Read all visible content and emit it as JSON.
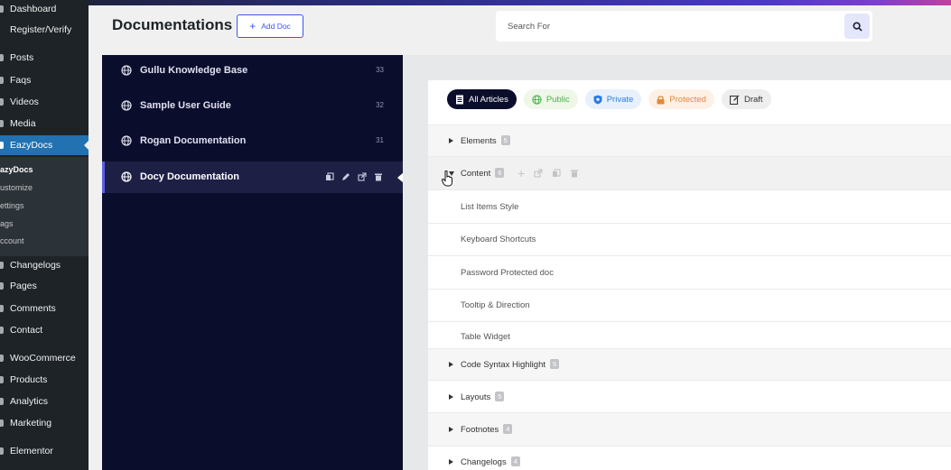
{
  "wp_menu": {
    "items": [
      {
        "label": "Dashboard"
      },
      {
        "label": "Register/Verify"
      },
      {
        "label": "Posts"
      },
      {
        "label": "Faqs"
      },
      {
        "label": "Videos"
      },
      {
        "label": "Media"
      },
      {
        "label": "EazyDocs"
      },
      {
        "label": "Changelogs"
      },
      {
        "label": "Pages"
      },
      {
        "label": "Comments"
      },
      {
        "label": "Contact"
      },
      {
        "label": "WooCommerce"
      },
      {
        "label": "Products"
      },
      {
        "label": "Analytics"
      },
      {
        "label": "Marketing"
      },
      {
        "label": "Elementor"
      }
    ],
    "submenu": [
      {
        "label": "azyDocs"
      },
      {
        "label": "ustomize"
      },
      {
        "label": "ettings"
      },
      {
        "label": "ags"
      },
      {
        "label": "ccount"
      }
    ]
  },
  "header": {
    "title": "Documentations",
    "add_doc_label": "Add Doc"
  },
  "search": {
    "placeholder": "Search For"
  },
  "docs": [
    {
      "name": "Gullu Knowledge Base",
      "count": "33"
    },
    {
      "name": "Sample User Guide",
      "count": "32"
    },
    {
      "name": "Rogan Documentation",
      "count": "31"
    },
    {
      "name": "Docy Documentation",
      "count": ""
    }
  ],
  "filters": {
    "all": "All Articles",
    "public": "Public",
    "private": "Private",
    "protected": "Protected",
    "draft": "Draft"
  },
  "articles": {
    "elements": {
      "label": "Elements",
      "count": "5"
    },
    "content": {
      "label": "Content",
      "count": "6"
    },
    "children": [
      {
        "label": "List Items Style"
      },
      {
        "label": "Keyboard Shortcuts"
      },
      {
        "label": "Password Protected doc"
      },
      {
        "label": "Tooltip & Direction"
      },
      {
        "label": "Table Widget"
      }
    ],
    "code": {
      "label": "Code Syntax Highlight",
      "count": "5"
    },
    "layouts": {
      "label": "Layouts",
      "count": "5"
    },
    "footnotes": {
      "label": "Footnotes",
      "count": "4"
    },
    "changelogs": {
      "label": "Changelogs",
      "count": "4"
    }
  },
  "colors": {
    "accent": "#3858e9",
    "docs_panel": "#0b0d2c",
    "wp_active": "#2271b1"
  }
}
